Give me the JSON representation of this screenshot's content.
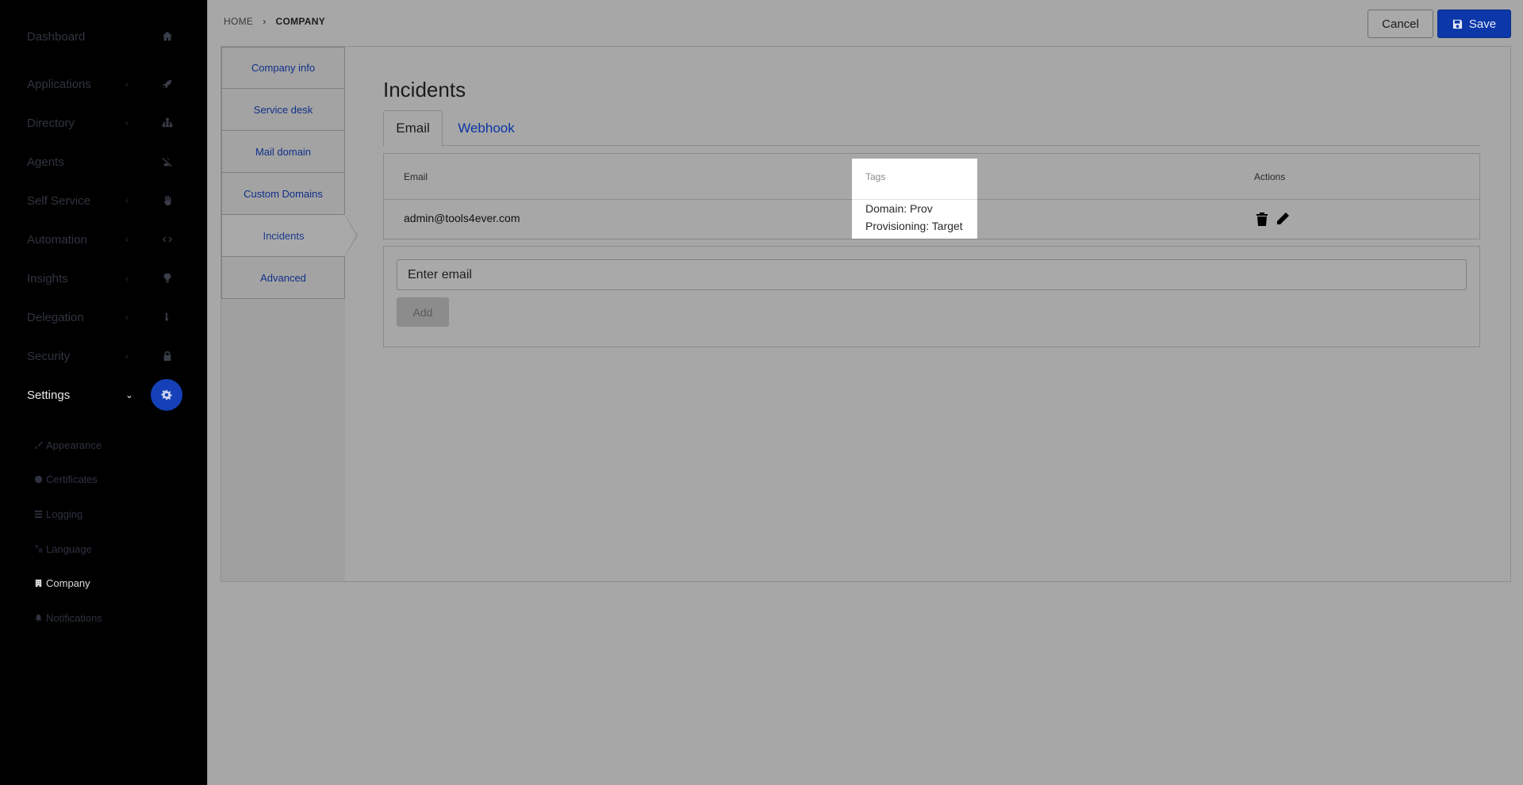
{
  "sidebar": {
    "items": [
      {
        "label": "Dashboard",
        "icon": "home-icon"
      },
      {
        "label": "Applications",
        "icon": "rocket-icon"
      },
      {
        "label": "Directory",
        "icon": "sitemap-icon"
      },
      {
        "label": "Agents",
        "icon": "user-slash-icon"
      },
      {
        "label": "Self Service",
        "icon": "hand-icon"
      },
      {
        "label": "Automation",
        "icon": "code-icon"
      },
      {
        "label": "Insights",
        "icon": "lightbulb-icon"
      },
      {
        "label": "Delegation",
        "icon": "arrow-icon"
      },
      {
        "label": "Security",
        "icon": "lock-icon"
      },
      {
        "label": "Settings",
        "icon": "gear-icon"
      }
    ],
    "chevron": "‹",
    "settings_chevron": "⌄",
    "sub_items": [
      {
        "label": "Appearance",
        "icon": "brush-icon"
      },
      {
        "label": "Certificates",
        "icon": "circle-icon"
      },
      {
        "label": "Logging",
        "icon": "list-icon"
      },
      {
        "label": "Language",
        "icon": "translate-icon"
      },
      {
        "label": "Company",
        "icon": "building-icon"
      },
      {
        "label": "Notifications",
        "icon": "bell-icon"
      }
    ]
  },
  "breadcrumb": {
    "home": "HOME",
    "separator": "›",
    "current": "COMPANY"
  },
  "toolbar": {
    "cancel_label": "Cancel",
    "save_label": "Save"
  },
  "vtabs": [
    "Company info",
    "Service desk",
    "Mail domain",
    "Custom Domains",
    "Incidents",
    "Advanced"
  ],
  "page": {
    "title": "Incidents"
  },
  "tabs": {
    "email": "Email",
    "webhook": "Webhook"
  },
  "table": {
    "headers": {
      "email": "Email",
      "tags": "Tags",
      "actions": "Actions"
    },
    "rows": [
      {
        "email": "admin@tools4ever.com",
        "tags": [
          "Domain: Prov",
          "Provisioning: Target"
        ]
      }
    ]
  },
  "add_form": {
    "placeholder": "Enter email",
    "add_label": "Add"
  }
}
